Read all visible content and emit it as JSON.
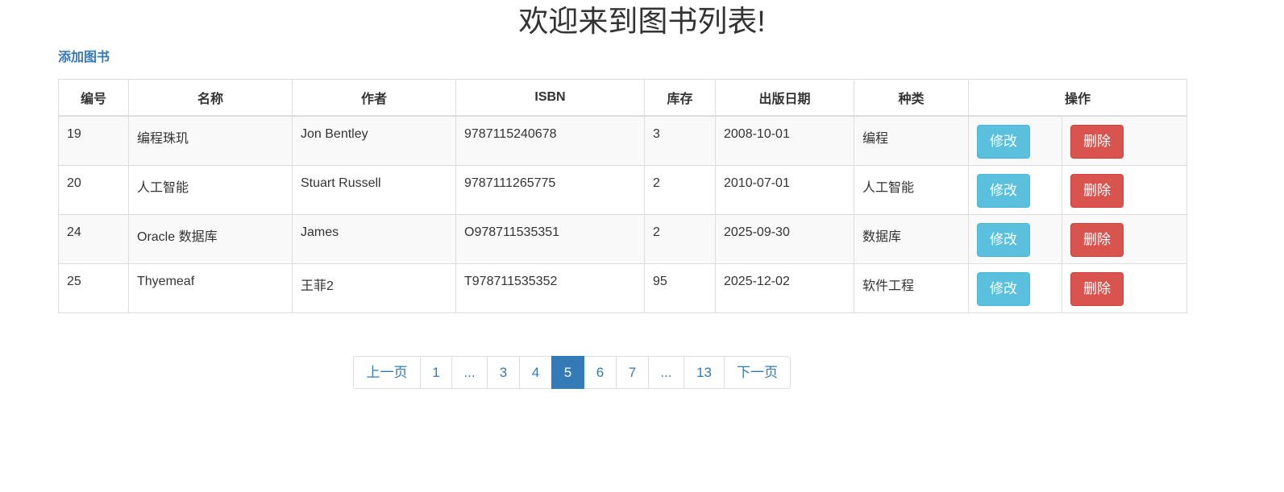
{
  "page": {
    "title": "欢迎来到图书列表!",
    "add_link": "添加图书"
  },
  "table": {
    "headers": [
      "编号",
      "名称",
      "作者",
      "ISBN",
      "库存",
      "出版日期",
      "种类",
      "操作"
    ],
    "rows": [
      {
        "id": "19",
        "name": "编程珠玑",
        "author": "Jon Bentley",
        "isbn": "9787115240678",
        "stock": "3",
        "date": "2008-10-01",
        "category": "编程",
        "edit": "修改",
        "delete": "删除"
      },
      {
        "id": "20",
        "name": "人工智能",
        "author": "Stuart Russell",
        "isbn": "9787111265775",
        "stock": "2",
        "date": "2010-07-01",
        "category": "人工智能",
        "edit": "修改",
        "delete": "删除"
      },
      {
        "id": "24",
        "name": "Oracle 数据库",
        "author": "James",
        "isbn": "O978711535351",
        "stock": "2",
        "date": "2025-09-30",
        "category": "数据库",
        "edit": "修改",
        "delete": "删除"
      },
      {
        "id": "25",
        "name": "Thyemeaf",
        "author": "王菲2",
        "isbn": "T978711535352",
        "stock": "95",
        "date": "2025-12-02",
        "category": "软件工程",
        "edit": "修改",
        "delete": "删除"
      }
    ]
  },
  "pagination": {
    "items": [
      "上一页",
      "1",
      "...",
      "3",
      "4",
      "5",
      "6",
      "7",
      "...",
      "13",
      "下一页"
    ],
    "active": "5"
  },
  "colors": {
    "link": "#337ab7",
    "edit_button": "#5bc0de",
    "delete_button": "#d9534f",
    "active_page": "#337ab7"
  }
}
